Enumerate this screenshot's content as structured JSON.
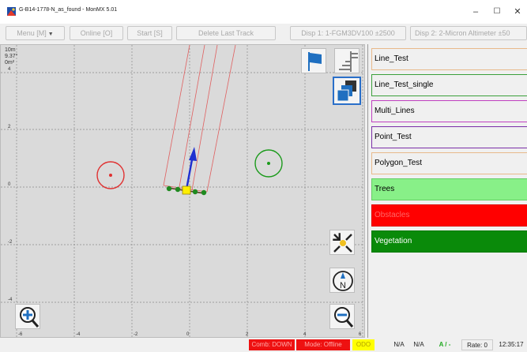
{
  "window": {
    "title": "G-B14-1778-N_as_found - MonMX 5.01",
    "controls": {
      "minimize": "–",
      "maximize": "☐",
      "close": "✕"
    }
  },
  "toolbar": {
    "menu": "Menu [M]",
    "online": "Online [O]",
    "start": "Start [S]",
    "delete_last_track": "Delete Last Track",
    "disp1": "Disp 1: 1-FGM3DV100 ±2500",
    "disp2": "Disp 2: 2-Micron Altimeter ±50"
  },
  "map": {
    "scale_info": [
      "10m",
      "9.37°",
      "0m²"
    ],
    "x_ticks": [
      "-6",
      "-4",
      "-2",
      "0",
      "2",
      "4",
      "6"
    ],
    "y_ticks": [
      "4",
      "2",
      "0",
      "-2",
      "-4"
    ],
    "colors": {
      "background": "#dadada",
      "grid": "#8a8a8a",
      "track_line": "#e06060",
      "heading_arrow": "#1f2fd0",
      "red_target": "#e03030",
      "green_target": "#1a9a1a"
    },
    "buttons": {
      "flag": "flag-icon",
      "layers_toggle": "layers-list-icon",
      "layer_stack": "layer-stack-icon",
      "center_view": "center-crosshair-icon",
      "north_up": "compass-north-icon",
      "compass_letter": "N",
      "zoom_out": "zoom-out-icon",
      "zoom_in": "zoom-in-icon"
    }
  },
  "layers": [
    {
      "name": "Line_Test",
      "bg": "#f0f0f0",
      "border": "#e8b98a",
      "color": "#000000"
    },
    {
      "name": "Line_Test_single",
      "bg": "#f0f0f0",
      "border": "#3aa03a",
      "color": "#000000"
    },
    {
      "name": "Multi_Lines",
      "bg": "#f0f0f0",
      "border": "#c040c0",
      "color": "#000000"
    },
    {
      "name": "Point_Test",
      "bg": "#f0f0f0",
      "border": "#7b2fa8",
      "color": "#000000"
    },
    {
      "name": "Polygon_Test",
      "bg": "#f0f0f0",
      "border": "#e8b98a",
      "color": "#000000"
    },
    {
      "name": "Trees",
      "bg": "#88f088",
      "border": "#66cc66",
      "color": "#000000"
    },
    {
      "name": "Obstacles",
      "bg": "#ff0000",
      "border": "#dd0000",
      "color": "#ff6666"
    },
    {
      "name": "Vegetation",
      "bg": "#0a8a0a",
      "border": "#0a7a0a",
      "color": "#ffffff"
    }
  ],
  "status": {
    "comb": "Comb: DOWN",
    "mode": "Mode: Offline",
    "odo": "ODO",
    "na1": "N/A",
    "na2": "N/A",
    "a": "A / -",
    "rate": "Rate: 0",
    "time": "12:35:17",
    "colors": {
      "comb_bg": "#ee1111",
      "mode_bg": "#ee1111",
      "odo_bg": "#ffff00",
      "a_color": "#22aa22"
    }
  }
}
